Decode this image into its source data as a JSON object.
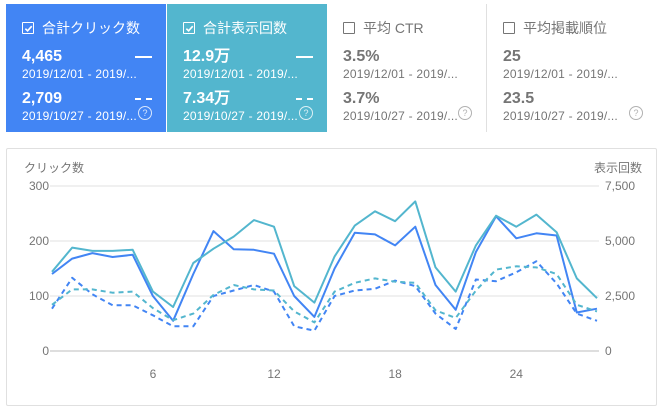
{
  "cards": [
    {
      "key": "clicks",
      "title": "合計クリック数",
      "checked": true,
      "value1": "4,465",
      "date1": "2019/12/01 - 2019/...",
      "value2": "2,709",
      "date2": "2019/10/27 - 2019/...",
      "help": "?"
    },
    {
      "key": "impr",
      "title": "合計表示回数",
      "checked": true,
      "value1": "12.9万",
      "date1": "2019/12/01 - 2019/...",
      "value2": "7.34万",
      "date2": "2019/10/27 - 2019/...",
      "help": "?"
    },
    {
      "key": "ctr",
      "title": "平均 CTR",
      "checked": false,
      "value1": "3.5%",
      "date1": "2019/12/01 - 2019/...",
      "value2": "3.7%",
      "date2": "2019/10/27 - 2019/...",
      "help": "?"
    },
    {
      "key": "pos",
      "title": "平均掲載順位",
      "checked": false,
      "value1": "25",
      "date1": "2019/12/01 - 2019/...",
      "value2": "23.5",
      "date2": "2019/10/27 - 2019/...",
      "help": "?"
    }
  ],
  "colors": {
    "clicks": "#4285f4",
    "impressions": "#53b6ce"
  },
  "chart_data": {
    "type": "line",
    "left_axis_label": "クリック数",
    "right_axis_label": "表示回数",
    "left_ticks": [
      "300",
      "200",
      "100",
      "0"
    ],
    "right_ticks": [
      "7,500",
      "5,000",
      "2,500",
      "0"
    ],
    "ylim_left": [
      0,
      300
    ],
    "ylim_right": [
      0,
      7500
    ],
    "x_tick_labels": [
      {
        "x": 6,
        "label": "6"
      },
      {
        "x": 12,
        "label": "12"
      },
      {
        "x": 18,
        "label": "18"
      },
      {
        "x": 24,
        "label": "24"
      }
    ],
    "x": [
      1,
      2,
      3,
      4,
      5,
      6,
      7,
      8,
      9,
      10,
      11,
      12,
      13,
      14,
      15,
      16,
      17,
      18,
      19,
      20,
      21,
      22,
      23,
      24,
      25,
      26,
      27,
      28
    ],
    "series": [
      {
        "name": "",
        "axis": "left",
        "style": "solid",
        "color": "clicks",
        "values": [
          140,
          168,
          178,
          171,
          175,
          100,
          55,
          140,
          218,
          185,
          184,
          177,
          100,
          62,
          150,
          215,
          212,
          192,
          226,
          120,
          75,
          180,
          245,
          205,
          214,
          210,
          70,
          77
        ]
      },
      {
        "name": "",
        "axis": "right",
        "style": "solid",
        "color": "impressions",
        "values": [
          3600,
          4700,
          4550,
          4550,
          4600,
          2700,
          2000,
          4000,
          4650,
          5200,
          5950,
          5650,
          2950,
          2200,
          4300,
          5700,
          6350,
          5900,
          6800,
          3800,
          2700,
          4800,
          6150,
          5650,
          6200,
          5400,
          3300,
          2400
        ]
      },
      {
        "name": "",
        "axis": "left",
        "style": "dashed",
        "color": "clicks",
        "values": [
          77,
          133,
          103,
          83,
          83,
          65,
          45,
          45,
          100,
          110,
          120,
          108,
          45,
          37,
          100,
          110,
          113,
          128,
          118,
          68,
          40,
          130,
          127,
          143,
          163,
          123,
          68,
          55
        ]
      },
      {
        "name": "",
        "axis": "right",
        "style": "dashed",
        "color": "impressions",
        "values": [
          2100,
          2800,
          2800,
          2650,
          2700,
          1950,
          1400,
          1700,
          2550,
          3000,
          2800,
          2750,
          1800,
          1300,
          2700,
          3100,
          3300,
          3150,
          3100,
          1850,
          1500,
          2750,
          3700,
          3850,
          3800,
          3500,
          2100,
          1800
        ]
      }
    ]
  }
}
